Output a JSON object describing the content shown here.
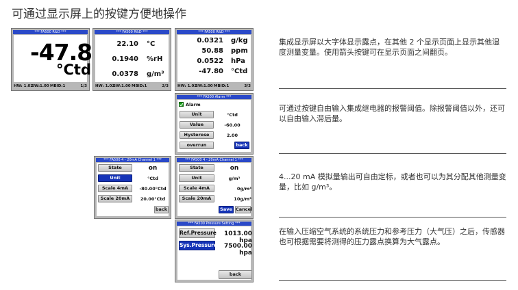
{
  "page": {
    "title": "可通过显示屏上的按键方便地操作"
  },
  "screens": {
    "big": {
      "status": "***  FA500  R&D  ***",
      "value": "-47.8",
      "unit": "°Ctd",
      "footer": {
        "hw": "HW: 1.02",
        "sw": "SW:1.00",
        "mbid": "MBID:1",
        "page": "1/3"
      }
    },
    "mid": {
      "status": "***  FA500  R&D  ***",
      "rows": [
        {
          "value": "22.10",
          "unit": "°C"
        },
        {
          "value": "0.1940",
          "unit": "%rH"
        },
        {
          "value": "0.0378",
          "unit": "g/m³"
        }
      ],
      "footer": {
        "hw": "HW: 1.02",
        "sw": "SW:1.00",
        "mbid": "MBID:1",
        "page": "2/3"
      }
    },
    "right": {
      "status": "***  FA500  R&D  ***",
      "rows": [
        {
          "value": "0.0321",
          "unit": "g/kg"
        },
        {
          "value": "50.88",
          "unit": "ppm"
        },
        {
          "value": "0.0522",
          "unit": "hPa"
        },
        {
          "value": "-47.80",
          "unit": "°Ctd"
        }
      ],
      "footer": {
        "hw": "HW: 1.02",
        "sw": "SW:1.00",
        "mbid": "MBID:1",
        "page": "3/3"
      }
    },
    "alarm": {
      "status": "***  FA500  Alarm  ***",
      "checkbox_label": "Alarm",
      "unit_button": "Unit",
      "unit_value": "°Ctd",
      "value_button": "Value",
      "value_value": "-60.00",
      "hyst_button": "Hysterese",
      "hyst_value": "2.00",
      "overrun_button": "overrun",
      "back_button": "back"
    },
    "analog1": {
      "status": "***  FA500  4 - 20mA Channel 1  ***",
      "state_button": "State",
      "state_value": "on",
      "unit_button": "Unit",
      "unit_value": "°Ctd",
      "scale4_button": "Scale 4mA",
      "scale4_value": "-80.00°Ctd",
      "scale20_button": "Scale 20mA",
      "scale20_value": "20.00°Ctd",
      "back_button": "back"
    },
    "analog2": {
      "status": "***  FA500  4 - 20mA Channel 1  ***",
      "state_button": "State",
      "state_value": "on",
      "unit_button": "Unit",
      "unit_value": "g/m³",
      "scale4_button": "Scale 4mA",
      "scale4_value": "0g/m³",
      "scale20_button": "Scale 20mA",
      "scale20_value": "10g/m³",
      "save_button": "Save",
      "cancel_button": "Cancel"
    },
    "pressure": {
      "status": "***  FA500  Pressure Setting  ***",
      "ref_button": "Ref.Pressure",
      "ref_value": "1013.00  hpa",
      "sys_button": "Sys.Pressure",
      "sys_value": "7500.00  hpa",
      "back_button": "back"
    }
  },
  "descriptions": {
    "d1": "集成显示屏以大字体显示露点，在其他 2 个显示页面上显示其他湿度测量变量。使用箭头按键可在显示页面之间翻页。",
    "d2": "可通过按键自由输入集成继电器的报警阈值。除报警阈值以外，还可以自由输入滞后量。",
    "d3": "4...20 mA 模拟量输出可自由定标，或者也可以为其分配其他测量变量，比如 g/m³。",
    "d4": "在输入压缩空气系统的系统压力和参考压力（大气压）之后，传感器也可根据需要将测得的压力露点换算为大气露点。"
  },
  "colors": {
    "accent_blue": "#1634b8",
    "status_bar": "#2a49c8",
    "check_green": "#1aa01a"
  }
}
